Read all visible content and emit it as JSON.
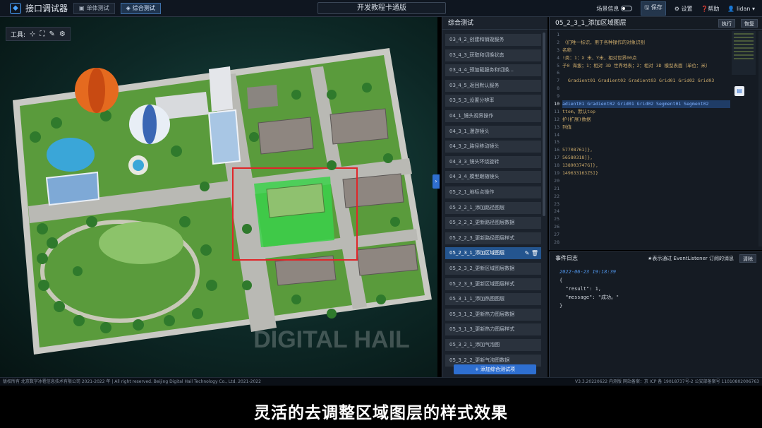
{
  "app": {
    "title": "接口调试器",
    "modes": [
      {
        "label": "单体测试",
        "active": false
      },
      {
        "label": "综合测试",
        "active": true
      }
    ],
    "center_title": "开发教程卡通版"
  },
  "topbar": {
    "scene_info": "场景信息",
    "save": "保存",
    "settings": "设置",
    "help": "帮助",
    "user": "lidan"
  },
  "toolbox": {
    "label": "工具:"
  },
  "list": {
    "header": "综合测试",
    "items": [
      "03_4_2_创建和销毁服务",
      "03_4_3_获取和切换状态",
      "03_4_4_预加载服务和切换...",
      "03_4_5_返回默认服务",
      "03_5_3_设置分辨率",
      "04_1_镜头视界操作",
      "04_3_1_漫游镜头",
      "04_3_2_路径移动镜头",
      "04_3_3_镜头环绕旋转",
      "04_3_4_模型跟随镜头",
      "05_2_1_地标点操作",
      "05_2_2_1_添加路径图层",
      "05_2_2_2_更新路径图层数据",
      "05_2_2_3_更新路径图层样式",
      "05_2_3_1_添加区域图层",
      "05_2_3_2_更新区域图层数据",
      "05_2_3_3_更新区域图层样式",
      "05_3_1_1_添加热图图层",
      "05_3_1_2_更新热力图层数据",
      "05_3_1_3_更新热力图层样式",
      "05_3_2_1_添加气泡图",
      "05_3_2_2_更新气泡图数据"
    ],
    "active_index": 14,
    "add_button": "+ 添加综合测试项"
  },
  "editor": {
    "title": "05_2_3_1_添加区域图层",
    "run": "执行",
    "restore": "恢复",
    "line_numbers": [
      "1",
      "2",
      "3",
      "4",
      "5",
      "6",
      "7",
      "8",
      "9",
      "10",
      "11",
      "12",
      "13",
      "14",
      "15",
      "16",
      "17",
      "18",
      "19",
      "20",
      "21",
      "22",
      "23",
      "24",
      "25",
      "26",
      "27",
      "28"
    ],
    "current_line": 10,
    "lines": [
      "",
      "（们唯一标识，用于各种操作的对象识别",
      "名称",
      "!类：1：X 米、Y米，相对世界00点",
      "子0 海拔；1：相对 3D 世界地表；2：相对 3D 模型表面（单位：米）",
      "",
      "  Gradient01 Gradient02 Gradient03 Grid01 Grid02 Grid03",
      "",
      "",
      "adient01 Gradient02 Grid01 Grid02 Segment01 Segment02",
      "ttom，默认top",
      "护(扩展)数据",
      "列值",
      "",
      "",
      "57708761]},",
      "56580318]},",
      "138903747G]},",
      "149633163Z5]}",
      "",
      "",
      "",
      "",
      "",
      "",
      "",
      "",
      ""
    ]
  },
  "log": {
    "title": "事件日志",
    "note": "★表示通过 EventListener 订阅的消息",
    "clear": "清除",
    "time": "2022-06-23 19:18:39",
    "body": "{\n  \"result\": 1,\n  \"message\": \"成功。\"\n}"
  },
  "footer": {
    "left": "版权所有 北京数字冰雹信息技术有限公司 2021-2022 年 | All right reserved. Beijing Digital Hail Technology Co., Ltd. 2021-2022",
    "right": "V3.3.20220622 内测版 网站备案：京 ICP 备 19018737号-2 公安部备案号 11010802006763"
  },
  "watermark": "DIGITAL HAIL",
  "subtitle": "灵活的去调整区域图层的样式效果",
  "colors": {
    "accent": "#2e6fd1",
    "selection_box": "#e0262a",
    "region_fill": "#3bd14a"
  }
}
